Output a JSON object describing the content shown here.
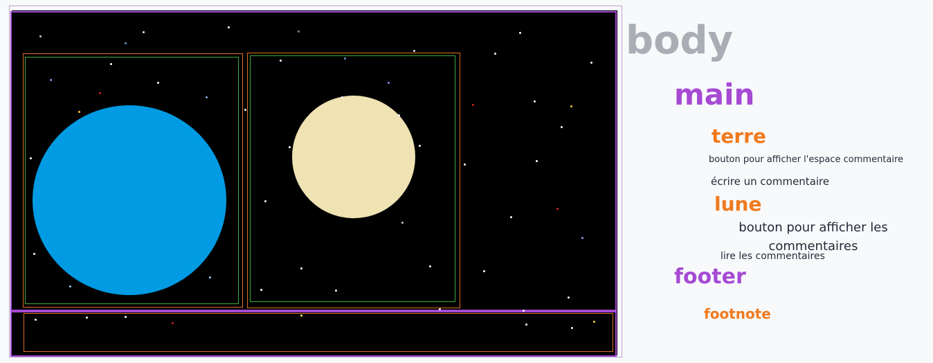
{
  "labels": {
    "body": "body",
    "main": "main",
    "terre": "terre",
    "terre_button": "bouton pour afficher l'espace commentaire",
    "terre_write": "écrire un commentaire",
    "lune": "lune",
    "lune_button": "bouton pour afficher les commentaires",
    "lune_read": "lire les commentaires",
    "footer": "footer",
    "footnote": "footnote"
  },
  "colors": {
    "body_label": "#a9aeb5",
    "main": "#a64ad4",
    "section": "#f07a1e",
    "text": "#1f2a36",
    "earth": "#009be2",
    "moon": "#efe3b3",
    "space": "#000000"
  }
}
